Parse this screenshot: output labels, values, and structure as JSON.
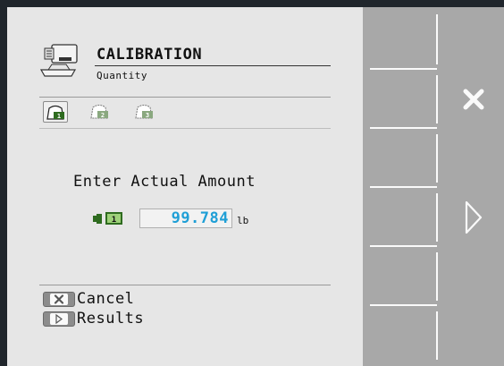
{
  "header": {
    "title": "CALIBRATION",
    "subtitle": "Quantity",
    "icon": "scale-icon"
  },
  "products": {
    "tabs": [
      {
        "icon": "bag-product-1-icon",
        "label": "1",
        "active": true
      },
      {
        "icon": "bag-product-2-icon",
        "label": "2",
        "active": false
      },
      {
        "icon": "bag-product-3-icon",
        "label": "3",
        "active": false
      }
    ]
  },
  "entry": {
    "prompt": "Enter Actual Amount",
    "product_label": "1",
    "value": "99.784",
    "unit": "lb"
  },
  "actions": {
    "cancel_label": "Cancel",
    "results_label": "Results"
  },
  "softkeys": {
    "cancel_icon": "x-icon",
    "next_icon": "right-arrow-icon"
  },
  "colors": {
    "value_text": "#1f9fd6",
    "softkey_bg": "#a8a8a8",
    "panel_bg": "#e6e6e6"
  }
}
